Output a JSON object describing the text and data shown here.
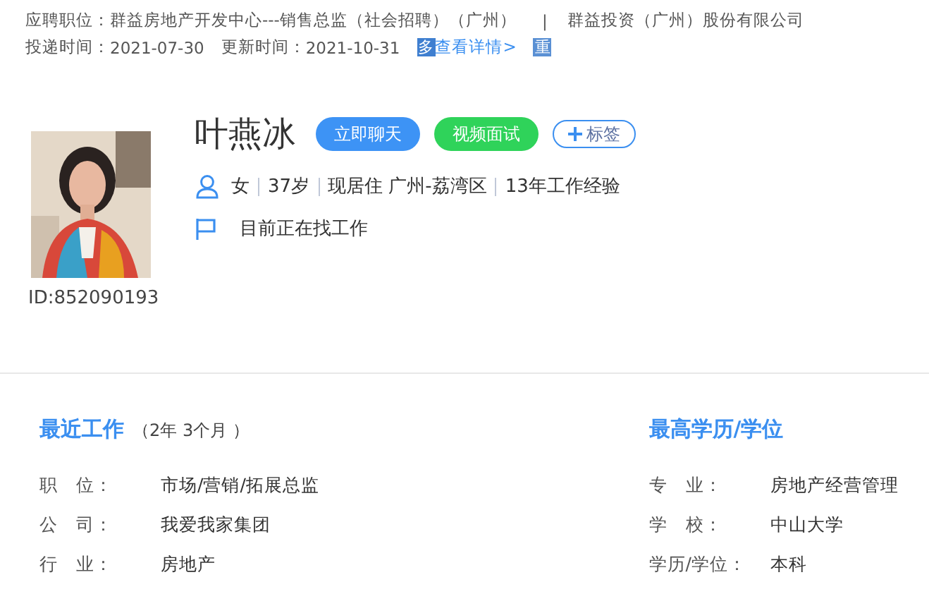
{
  "header": {
    "position_label": "应聘职位：",
    "position": "群益房地产开发中心---销售总监（社会招聘）（广州）",
    "separator": "|",
    "company": "群益投资（广州）股份有限公司",
    "sent_label": "投递时间：",
    "sent": "2021-07-30",
    "updated_label": "更新时间：",
    "updated": "2021-10-31",
    "detail_badge": "多",
    "detail_link": "查看详情>",
    "repeat_badge": "重"
  },
  "profile": {
    "id": "ID:852090193",
    "name": "叶燕冰",
    "buttons": [
      {
        "label": "立即聊天",
        "kind": "chat"
      },
      {
        "label": "视频面试",
        "kind": "video"
      },
      {
        "label": "标签",
        "kind": "tag"
      }
    ],
    "facts": [
      "女",
      "37岁",
      "现居住 广州-荔湾区",
      "13年工作经验"
    ],
    "status": "目前正在找工作"
  },
  "recent_work": {
    "title": "最近工作",
    "duration": "（2年 3个月 ）",
    "rows": [
      {
        "label": "职　位：",
        "value": "市场/营销/拓展总监"
      },
      {
        "label": "公　司：",
        "value": "我爱我家集团"
      },
      {
        "label": "行　业：",
        "value": "房地产"
      }
    ]
  },
  "education": {
    "title": "最高学历/学位",
    "rows": [
      {
        "label": "专　业：",
        "value": "房地产经营管理"
      },
      {
        "label": "学　校：",
        "value": "中山大学"
      },
      {
        "label": "学历/学位：",
        "value": "本科"
      }
    ]
  }
}
